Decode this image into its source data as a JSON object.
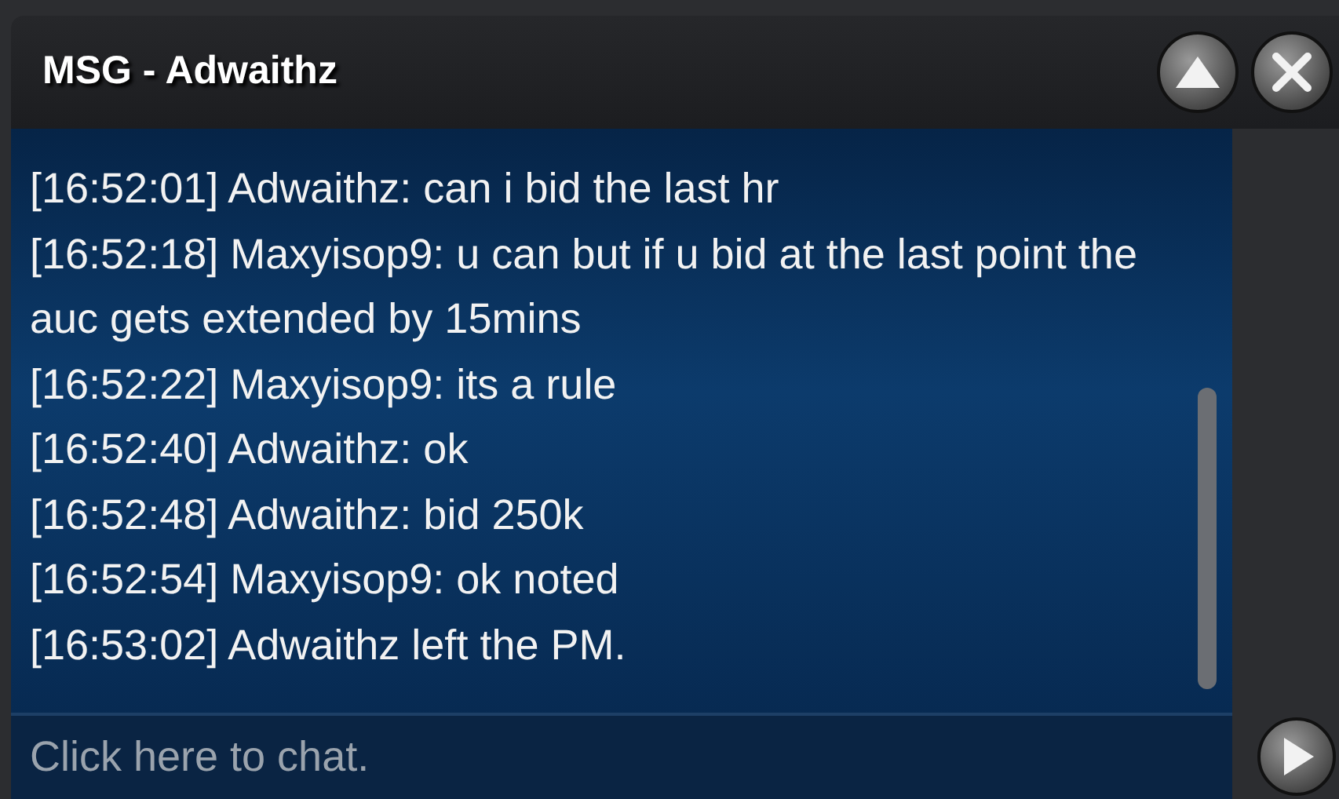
{
  "window": {
    "title": "MSG - Adwaithz"
  },
  "messages": [
    {
      "time": "[16:52:01]",
      "text": "Adwaithz: can i bid the last hr"
    },
    {
      "time": "[16:52:18]",
      "text": "Maxyisop9: u can but if u bid at the last point the auc gets extended by 15mins"
    },
    {
      "time": "[16:52:22]",
      "text": "Maxyisop9: its a rule"
    },
    {
      "time": "[16:52:40]",
      "text": "Adwaithz: ok"
    },
    {
      "time": "[16:52:48]",
      "text": "Adwaithz: bid 250k"
    },
    {
      "time": "[16:52:54]",
      "text": "Maxyisop9: ok noted"
    },
    {
      "time": "[16:53:02]",
      "text": "Adwaithz left the PM."
    }
  ],
  "chat_input": {
    "placeholder": "Click here to chat."
  }
}
